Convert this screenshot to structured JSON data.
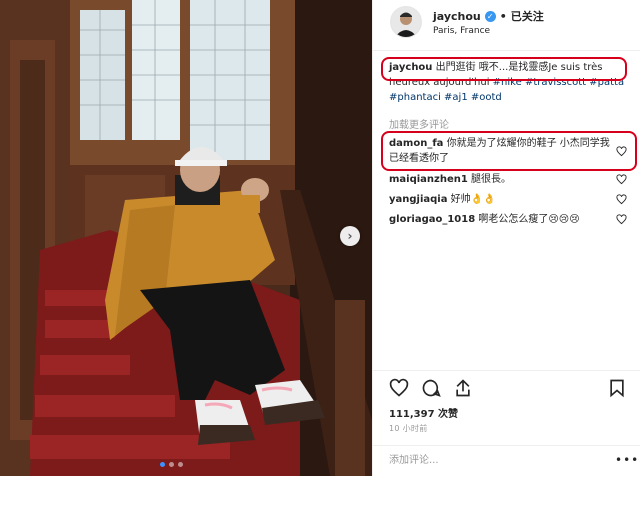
{
  "post": {
    "username": "jaychou",
    "separator": "•",
    "follow_state": "已关注",
    "location": "Paris, France",
    "caption": {
      "username": "jaychou",
      "text": " 出門逛街 哦不...是找靈感Je suis très heureux aujourd'hui ",
      "tags": [
        "#nike",
        "#travisscott",
        "#patta",
        "#phantaci",
        "#aj1",
        "#ootd"
      ]
    },
    "load_more": "加载更多评论",
    "comments": [
      {
        "username": "damon_fa",
        "text": " 你就是为了炫耀你的鞋子 小杰同学我已经看透你了"
      },
      {
        "username": "maiqianzhen1",
        "text": " 腿很長。"
      },
      {
        "username": "yangjiaqia",
        "text": " 好帅👌👌"
      },
      {
        "username": "gloriagao_1018",
        "text": " 啊老公怎么瘦了😢😢😢"
      }
    ],
    "likes": "111,397 次赞",
    "time": "10 小时前",
    "add_comment_placeholder": "添加评论...",
    "more": "•••"
  },
  "icons": {
    "verified": "verified-badge-icon",
    "like": "heart-icon",
    "comment": "comment-icon",
    "share": "share-icon",
    "save": "bookmark-icon",
    "next": "chevron-right-icon"
  },
  "colors": {
    "highlight": "#d6001c",
    "link": "#003569",
    "verified": "#3897f0"
  }
}
